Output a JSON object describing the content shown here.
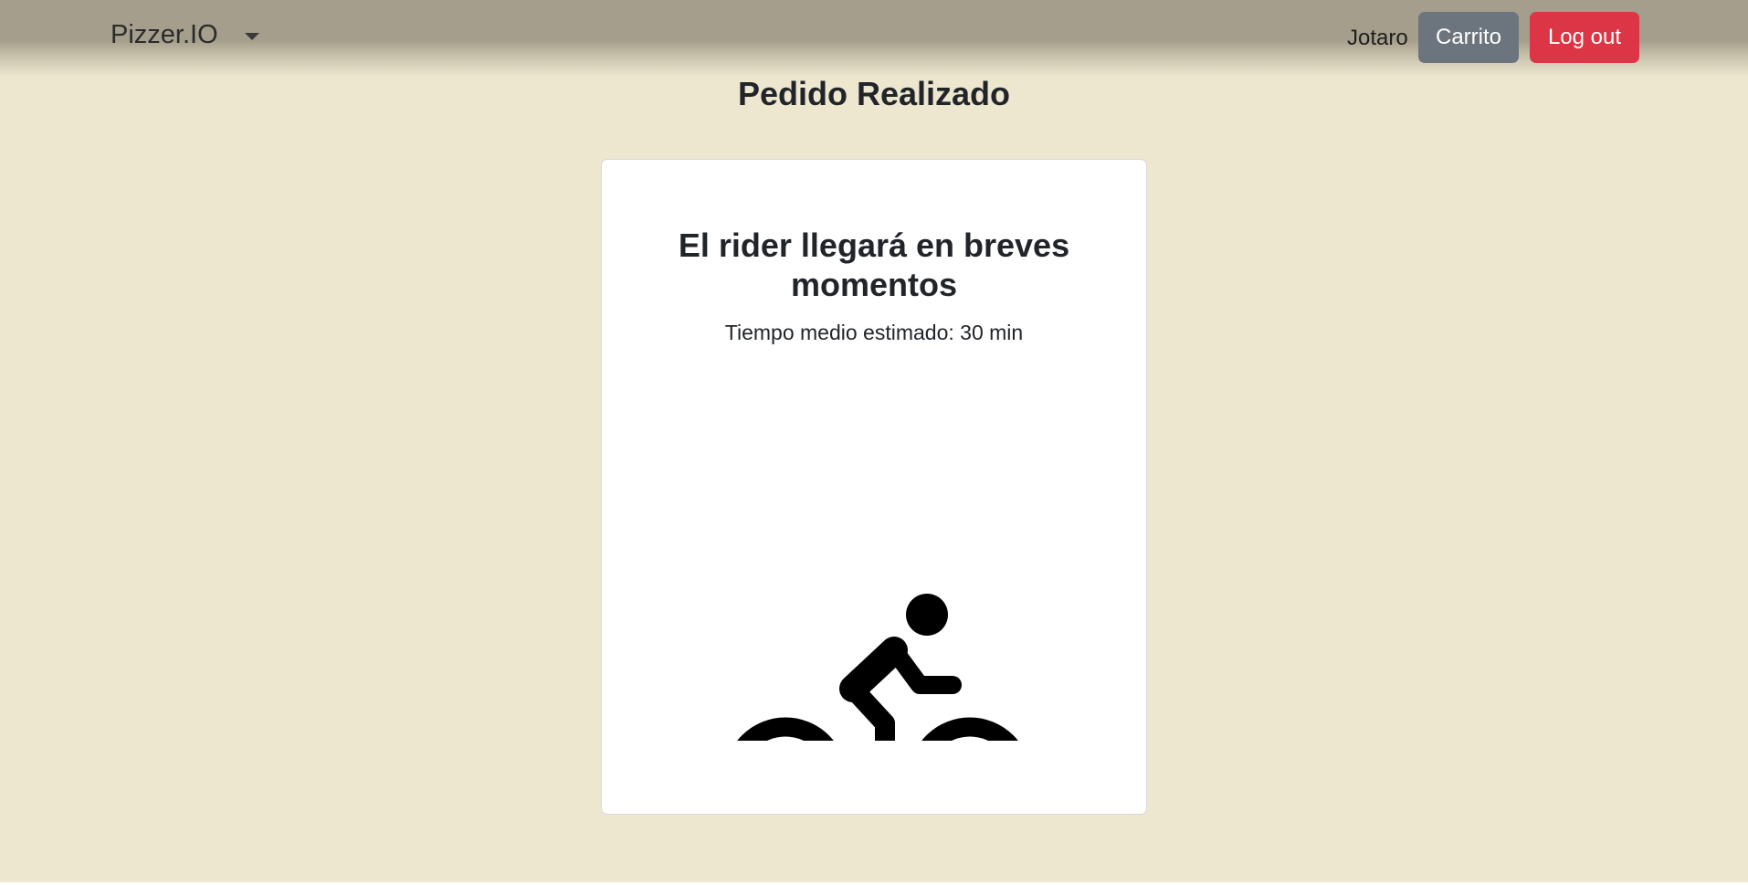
{
  "navbar": {
    "brand": "Pizzer.IO",
    "username": "Jotaro",
    "cart_label": "Carrito",
    "logout_label": "Log out",
    "dropdown_icon": "caret-down-icon"
  },
  "main": {
    "title": "Pedido Realizado",
    "card": {
      "title": "El rider llegará en breves momentos",
      "subtitle": "Tiempo medio estimado: 30 min",
      "icon": "bicycle-rider-icon"
    }
  },
  "colors": {
    "background": "#ede7d0",
    "navbar": "#a59e8c",
    "cart_button": "#6c757d",
    "logout_button": "#dc3545"
  }
}
